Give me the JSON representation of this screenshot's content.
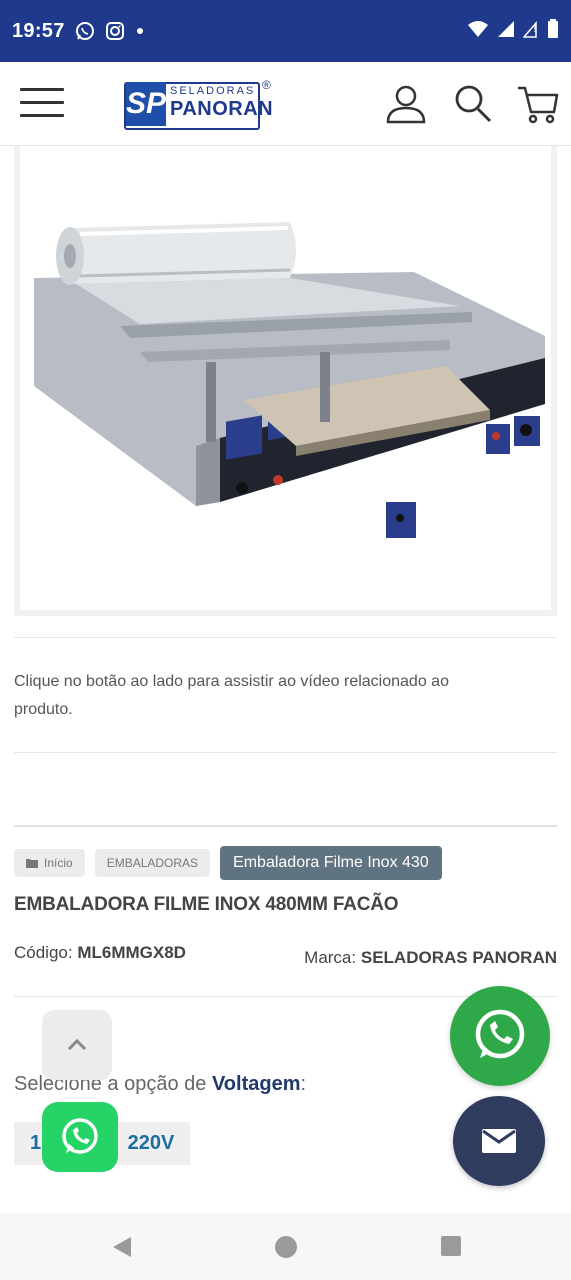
{
  "status_bar": {
    "time": "19:57",
    "icons": [
      "whatsapp-icon",
      "instagram-icon",
      "dot-icon",
      "wifi-icon",
      "signal-icon",
      "battery-icon"
    ]
  },
  "header": {
    "logo": {
      "line1": "SELADORAS",
      "line2": "PANORAN",
      "mark": "SP",
      "registered": "®"
    },
    "icons": [
      "menu-icon",
      "user-icon",
      "search-icon",
      "cart-icon"
    ]
  },
  "video_note": "Clique no botão ao lado para assistir ao vídeo relacionado ao produto.",
  "breadcrumb": {
    "items": [
      {
        "label": "Início",
        "icon": "folder-icon"
      },
      {
        "label": "EMBALADORAS"
      },
      {
        "label": "Embaladora Filme Inox 430"
      }
    ]
  },
  "product": {
    "title": "EMBALADORA FILME INOX 480MM FACÃO",
    "code_label": "Código:",
    "code_value": "ML6MMGX8D",
    "brand_label": "Marca:",
    "brand_value": "SELADORAS PANORAN"
  },
  "options": {
    "prefix": "Selecione a opção de",
    "name": "Voltagem",
    "suffix": ":",
    "values": [
      "1",
      "220V"
    ]
  },
  "floating": [
    "chevron-up-icon",
    "whatsapp-icon",
    "email-icon"
  ],
  "colors": {
    "brand_blue": "#1f3a8c",
    "whatsapp_green": "#25d366",
    "mail_button": "#2f3c5e",
    "crumb_active": "#5f7480"
  }
}
